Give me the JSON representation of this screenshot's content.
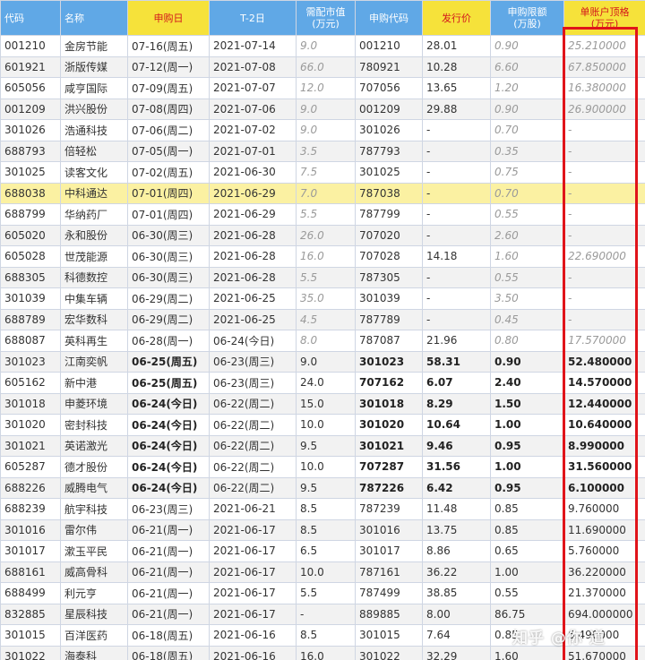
{
  "table": {
    "headers": [
      "代码",
      "名称",
      "申购日",
      "T-2日",
      "需配市值\n(万元)",
      "申购代码",
      "发行价",
      "申购限额\n(万股)",
      "单账户顶格\n(万元)"
    ],
    "rows": [
      {
        "code": "001210",
        "name": "金房节能",
        "sub_date": "07-16(周五)",
        "t2": "2021-07-14",
        "mv": "9.0",
        "sub_code": "001210",
        "price": "28.01",
        "limit": "0.90",
        "top": "25.210000"
      },
      {
        "code": "601921",
        "name": "浙版传媒",
        "sub_date": "07-12(周一)",
        "t2": "2021-07-08",
        "mv": "66.0",
        "sub_code": "780921",
        "price": "10.28",
        "limit": "6.60",
        "top": "67.850000"
      },
      {
        "code": "605056",
        "name": "咸亨国际",
        "sub_date": "07-09(周五)",
        "t2": "2021-07-07",
        "mv": "12.0",
        "sub_code": "707056",
        "price": "13.65",
        "limit": "1.20",
        "top": "16.380000"
      },
      {
        "code": "001209",
        "name": "洪兴股份",
        "sub_date": "07-08(周四)",
        "t2": "2021-07-06",
        "mv": "9.0",
        "sub_code": "001209",
        "price": "29.88",
        "limit": "0.90",
        "top": "26.900000"
      },
      {
        "code": "301026",
        "name": "浩通科技",
        "sub_date": "07-06(周二)",
        "t2": "2021-07-02",
        "mv": "9.0",
        "sub_code": "301026",
        "price": "-",
        "limit": "0.70",
        "top": "-"
      },
      {
        "code": "688793",
        "name": "倍轻松",
        "sub_date": "07-05(周一)",
        "t2": "2021-07-01",
        "mv": "3.5",
        "sub_code": "787793",
        "price": "-",
        "limit": "0.35",
        "top": "-"
      },
      {
        "code": "301025",
        "name": "读客文化",
        "sub_date": "07-02(周五)",
        "t2": "2021-06-30",
        "mv": "7.5",
        "sub_code": "301025",
        "price": "-",
        "limit": "0.75",
        "top": "-"
      },
      {
        "code": "688038",
        "name": "中科通达",
        "sub_date": "07-01(周四)",
        "t2": "2021-06-29",
        "mv": "7.0",
        "sub_code": "787038",
        "price": "-",
        "limit": "0.70",
        "top": "-"
      },
      {
        "code": "688799",
        "name": "华纳药厂",
        "sub_date": "07-01(周四)",
        "t2": "2021-06-29",
        "mv": "5.5",
        "sub_code": "787799",
        "price": "-",
        "limit": "0.55",
        "top": "-"
      },
      {
        "code": "605020",
        "name": "永和股份",
        "sub_date": "06-30(周三)",
        "t2": "2021-06-28",
        "mv": "26.0",
        "sub_code": "707020",
        "price": "-",
        "limit": "2.60",
        "top": "-"
      },
      {
        "code": "605028",
        "name": "世茂能源",
        "sub_date": "06-30(周三)",
        "t2": "2021-06-28",
        "mv": "16.0",
        "sub_code": "707028",
        "price": "14.18",
        "limit": "1.60",
        "top": "22.690000"
      },
      {
        "code": "688305",
        "name": "科德数控",
        "sub_date": "06-30(周三)",
        "t2": "2021-06-28",
        "mv": "5.5",
        "sub_code": "787305",
        "price": "-",
        "limit": "0.55",
        "top": "-"
      },
      {
        "code": "301039",
        "name": "中集车辆",
        "sub_date": "06-29(周二)",
        "t2": "2021-06-25",
        "mv": "35.0",
        "sub_code": "301039",
        "price": "-",
        "limit": "3.50",
        "top": "-"
      },
      {
        "code": "688789",
        "name": "宏华数科",
        "sub_date": "06-29(周二)",
        "t2": "2021-06-25",
        "mv": "4.5",
        "sub_code": "787789",
        "price": "-",
        "limit": "0.45",
        "top": "-"
      },
      {
        "code": "688087",
        "name": "英科再生",
        "sub_date": "06-28(周一)",
        "t2": "06-24(今日)",
        "mv": "8.0",
        "sub_code": "787087",
        "price": "21.96",
        "limit": "0.80",
        "top": "17.570000"
      },
      {
        "code": "301023",
        "name": "江南奕帆",
        "sub_date": "06-25(周五)",
        "t2": "06-23(周三)",
        "mv": "9.0",
        "sub_code": "301023",
        "price": "58.31",
        "limit": "0.90",
        "top": "52.480000"
      },
      {
        "code": "605162",
        "name": "新中港",
        "sub_date": "06-25(周五)",
        "t2": "06-23(周三)",
        "mv": "24.0",
        "sub_code": "707162",
        "price": "6.07",
        "limit": "2.40",
        "top": "14.570000"
      },
      {
        "code": "301018",
        "name": "申菱环境",
        "sub_date": "06-24(今日)",
        "t2": "06-22(周二)",
        "mv": "15.0",
        "sub_code": "301018",
        "price": "8.29",
        "limit": "1.50",
        "top": "12.440000"
      },
      {
        "code": "301020",
        "name": "密封科技",
        "sub_date": "06-24(今日)",
        "t2": "06-22(周二)",
        "mv": "10.0",
        "sub_code": "301020",
        "price": "10.64",
        "limit": "1.00",
        "top": "10.640000"
      },
      {
        "code": "301021",
        "name": "英诺激光",
        "sub_date": "06-24(今日)",
        "t2": "06-22(周二)",
        "mv": "9.5",
        "sub_code": "301021",
        "price": "9.46",
        "limit": "0.95",
        "top": "8.990000"
      },
      {
        "code": "605287",
        "name": "德才股份",
        "sub_date": "06-24(今日)",
        "t2": "06-22(周二)",
        "mv": "10.0",
        "sub_code": "707287",
        "price": "31.56",
        "limit": "1.00",
        "top": "31.560000"
      },
      {
        "code": "688226",
        "name": "威腾电气",
        "sub_date": "06-24(今日)",
        "t2": "06-22(周二)",
        "mv": "9.5",
        "sub_code": "787226",
        "price": "6.42",
        "limit": "0.95",
        "top": "6.100000"
      },
      {
        "code": "688239",
        "name": "航宇科技",
        "sub_date": "06-23(周三)",
        "t2": "2021-06-21",
        "mv": "8.5",
        "sub_code": "787239",
        "price": "11.48",
        "limit": "0.85",
        "top": "9.760000"
      },
      {
        "code": "301016",
        "name": "雷尔伟",
        "sub_date": "06-21(周一)",
        "t2": "2021-06-17",
        "mv": "8.5",
        "sub_code": "301016",
        "price": "13.75",
        "limit": "0.85",
        "top": "11.690000"
      },
      {
        "code": "301017",
        "name": "漱玉平民",
        "sub_date": "06-21(周一)",
        "t2": "2021-06-17",
        "mv": "6.5",
        "sub_code": "301017",
        "price": "8.86",
        "limit": "0.65",
        "top": "5.760000"
      },
      {
        "code": "688161",
        "name": "威高骨科",
        "sub_date": "06-21(周一)",
        "t2": "2021-06-17",
        "mv": "10.0",
        "sub_code": "787161",
        "price": "36.22",
        "limit": "1.00",
        "top": "36.220000"
      },
      {
        "code": "688499",
        "name": "利元亨",
        "sub_date": "06-21(周一)",
        "t2": "2021-06-17",
        "mv": "5.5",
        "sub_code": "787499",
        "price": "38.85",
        "limit": "0.55",
        "top": "21.370000"
      },
      {
        "code": "832885",
        "name": "星辰科技",
        "sub_date": "06-21(周一)",
        "t2": "2021-06-17",
        "mv": "-",
        "sub_code": "889885",
        "price": "8.00",
        "limit": "86.75",
        "top": "694.000000"
      },
      {
        "code": "301015",
        "name": "百洋医药",
        "sub_date": "06-18(周五)",
        "t2": "2021-06-16",
        "mv": "8.5",
        "sub_code": "301015",
        "price": "7.64",
        "limit": "0.85",
        "top": "6.490000"
      },
      {
        "code": "301022",
        "name": "海泰科",
        "sub_date": "06-18(周五)",
        "t2": "2021-06-16",
        "mv": "16.0",
        "sub_code": "301022",
        "price": "32.29",
        "limit": "1.60",
        "top": "51.670000"
      }
    ]
  },
  "watermark": "知乎 @你 道"
}
